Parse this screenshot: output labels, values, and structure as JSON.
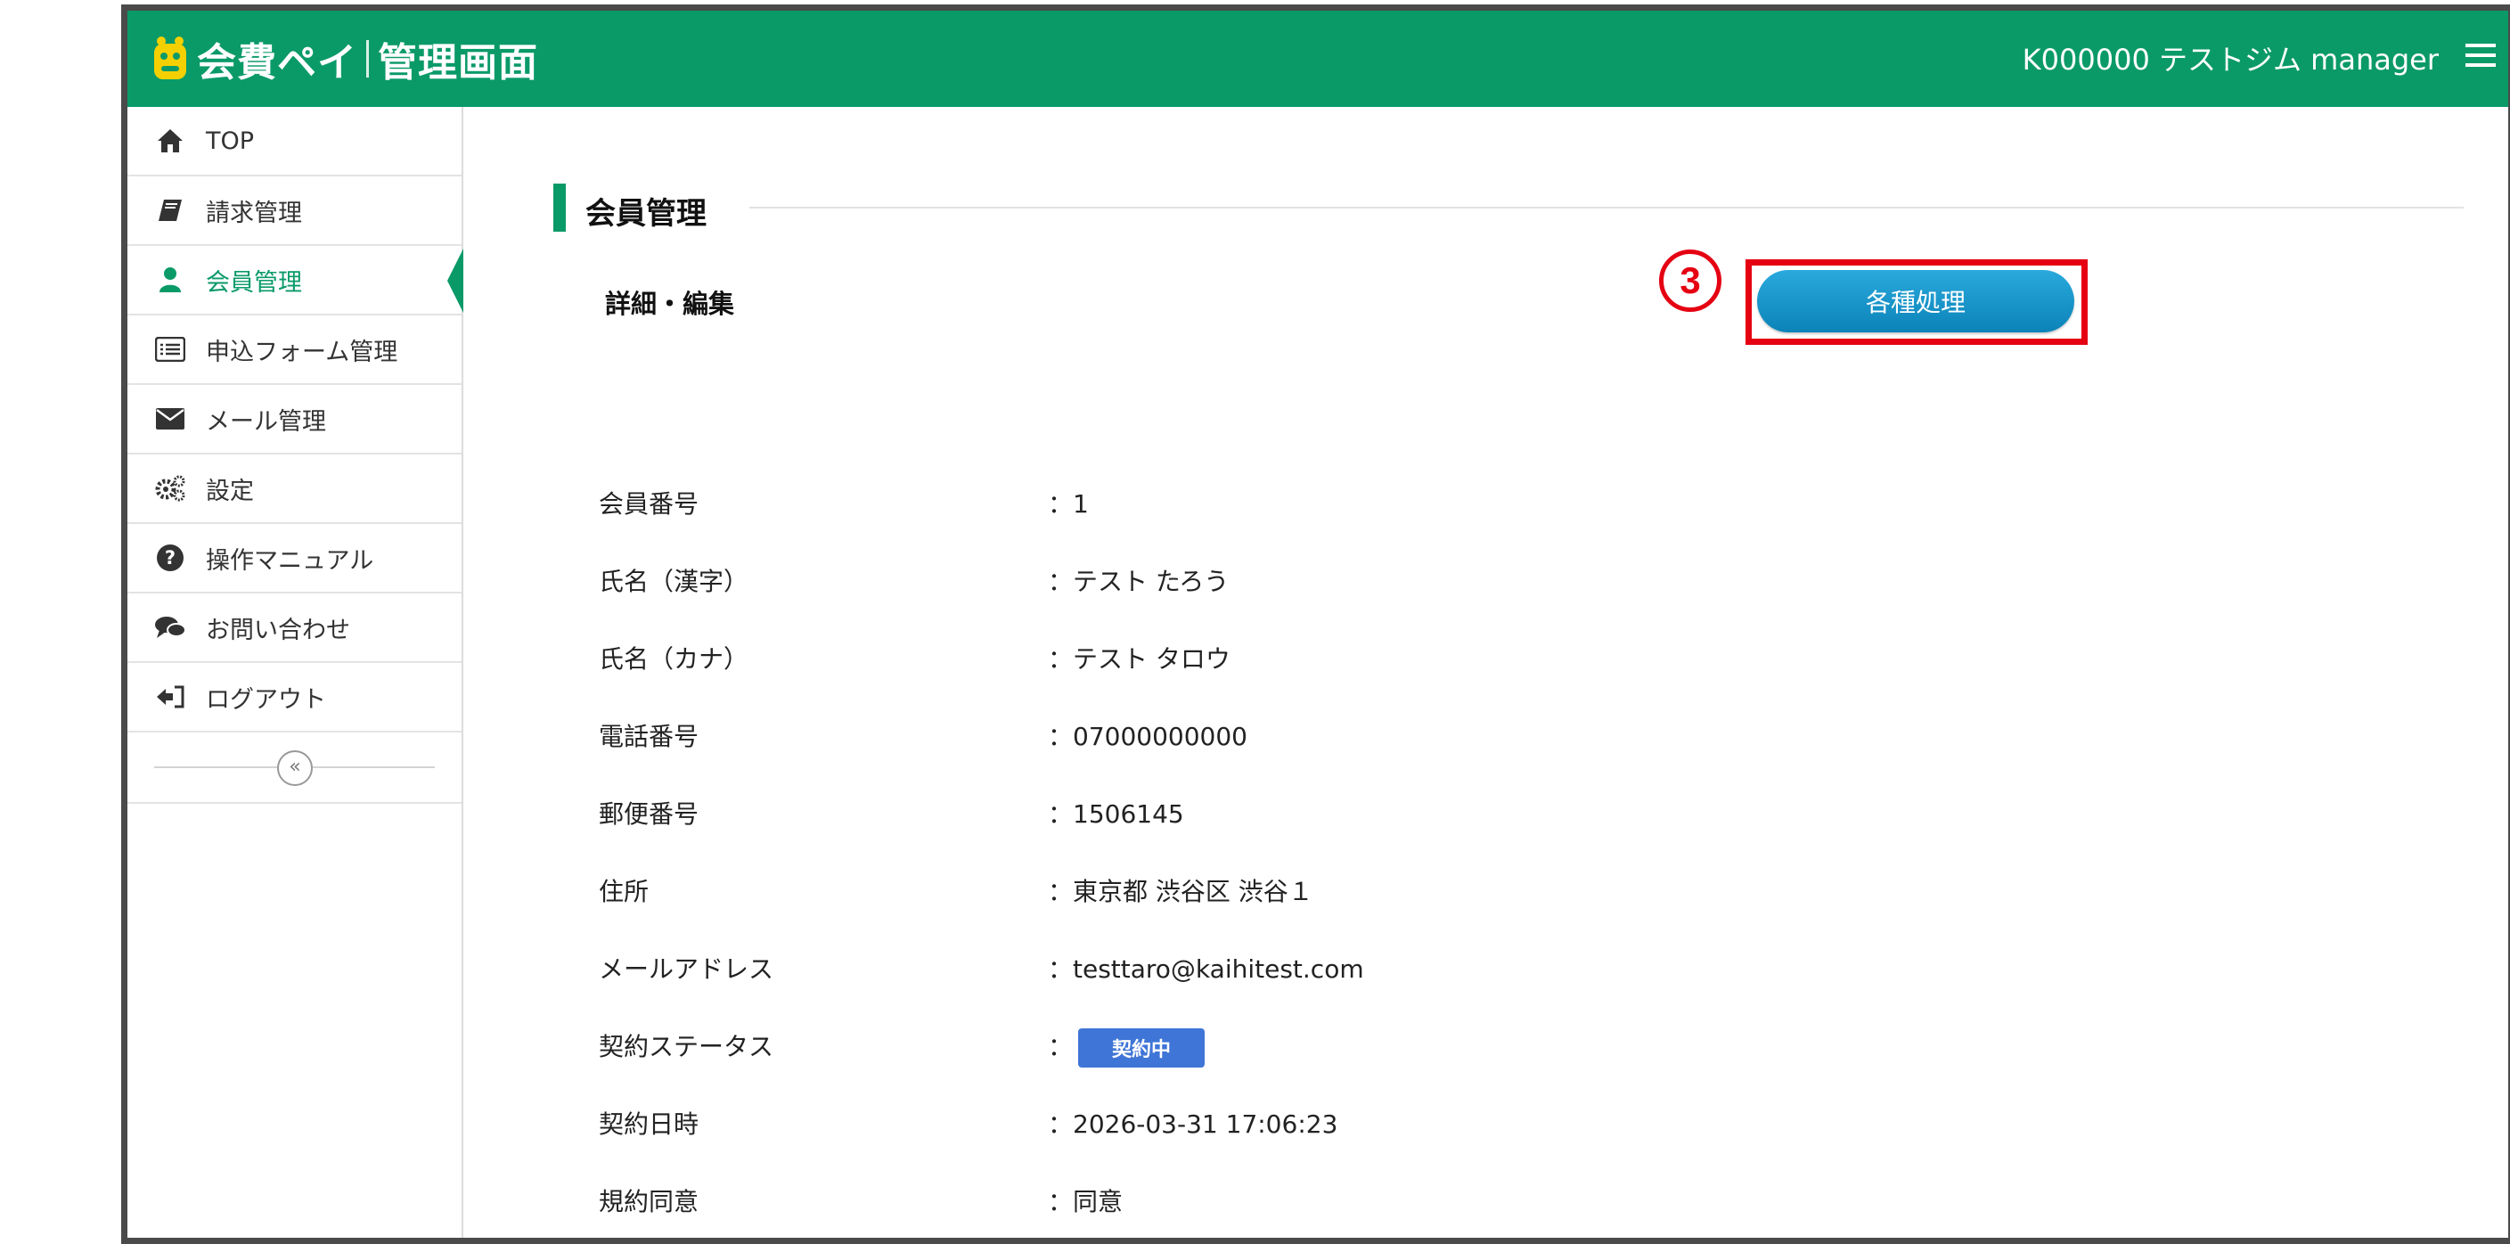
{
  "header": {
    "brand_part1": "会費ペイ",
    "brand_part2": "管理画面",
    "account": "K000000 テストジム manager"
  },
  "sidebar": {
    "items": [
      {
        "label": "TOP",
        "icon": "home-icon"
      },
      {
        "label": "請求管理",
        "icon": "book-icon"
      },
      {
        "label": "会員管理",
        "icon": "user-icon",
        "active": true
      },
      {
        "label": "申込フォーム管理",
        "icon": "list-icon"
      },
      {
        "label": "メール管理",
        "icon": "envelope-icon"
      },
      {
        "label": "設定",
        "icon": "gears-icon"
      },
      {
        "label": "操作マニュアル",
        "icon": "question-icon"
      },
      {
        "label": "お問い合わせ",
        "icon": "chat-icon"
      },
      {
        "label": "ログアウト",
        "icon": "logout-icon"
      }
    ],
    "collapse_glyph": "«"
  },
  "main": {
    "section_title": "会員管理",
    "sub_title": "詳細・編集",
    "action_button": "各種処理",
    "step_marker": "3",
    "fields": [
      {
        "label": "会員番号",
        "value": "：1"
      },
      {
        "label": "氏名（漢字）",
        "value": "：テスト たろう"
      },
      {
        "label": "氏名（カナ）",
        "value": "：テスト タロウ"
      },
      {
        "label": "電話番号",
        "value": "：07000000000"
      },
      {
        "label": "郵便番号",
        "value": "：1506145"
      },
      {
        "label": "住所",
        "value": "：東京都 渋谷区 渋谷１"
      },
      {
        "label": "メールアドレス",
        "value": "：testtaro@kaihitest.com"
      },
      {
        "label": "契約ステータス",
        "value": "：",
        "badge": "契約中"
      },
      {
        "label": "契約日時",
        "value": "：2026-03-31 17:06:23"
      },
      {
        "label": "規約同意",
        "value": "：同意"
      }
    ]
  },
  "colors": {
    "brand_green": "#0a9a68",
    "button_blue": "#1b96cc",
    "highlight_red": "#e50012",
    "badge_blue": "#3f75d6"
  }
}
